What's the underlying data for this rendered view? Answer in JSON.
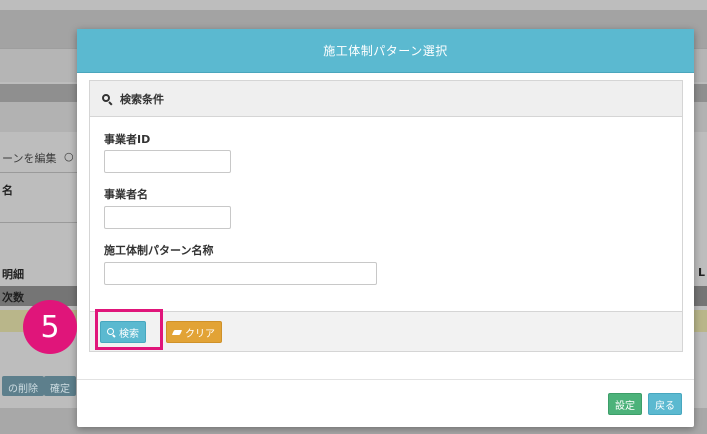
{
  "background": {
    "edit_option": "ーンを編集",
    "radio_text": "○",
    "field_fragment": "名",
    "section_fragment": "明細",
    "column_fragment": "次数",
    "right_fragment": "L",
    "buttons": [
      "の削除",
      "確定"
    ]
  },
  "modal": {
    "title": "施工体制パターン選択",
    "panel": {
      "heading": "検索条件",
      "fields": [
        {
          "label": "事業者ID",
          "value": ""
        },
        {
          "label": "事業者名",
          "value": ""
        },
        {
          "label": "施工体制パターン名称",
          "value": ""
        }
      ],
      "search_button": "検索",
      "clear_button": "クリア"
    },
    "footer": {
      "set_button": "設定",
      "back_button": "戻る"
    }
  },
  "annotation": {
    "step_number": "5",
    "color": "#e0157a"
  },
  "colors": {
    "header": "#5bb9d0",
    "search_button": "#5bb9d0",
    "clear_button": "#e2a336",
    "set_button": "#4cb27a",
    "back_button": "#5bb9d0"
  },
  "icons": {
    "search": "search-icon",
    "clear": "eraser-icon"
  }
}
